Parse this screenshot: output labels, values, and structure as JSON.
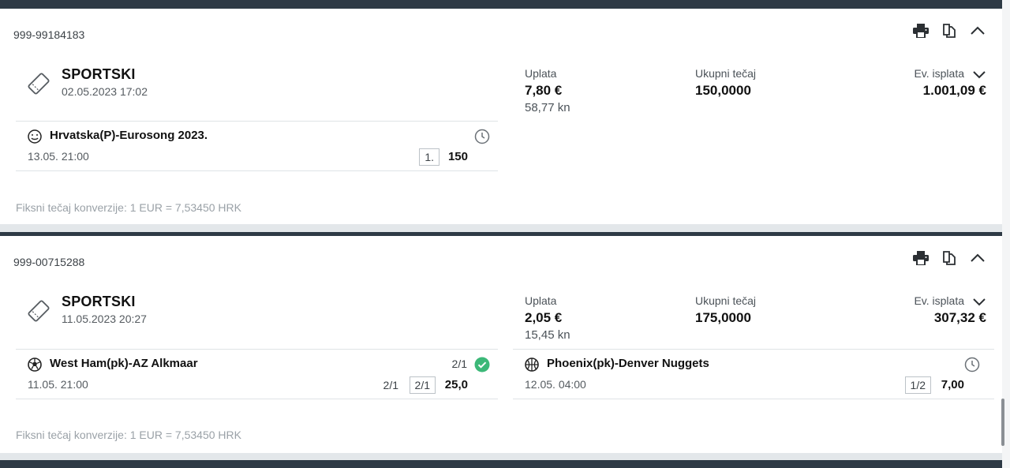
{
  "tickets": [
    {
      "id": "999-99184183",
      "type": "SPORTSKI",
      "date": "02.05.2023 17:02",
      "uplata_label": "Uplata",
      "uplata_eur": "7,80 €",
      "uplata_kn": "58,77 kn",
      "tecaj_label": "Ukupni tečaj",
      "tecaj": "150,0000",
      "isplata_label": "Ev. isplata",
      "isplata": "1.001,09 €",
      "events": [
        {
          "icon": "smiley-icon",
          "name": "Hrvatska(P)-Eurosong 2023.",
          "date": "13.05. 21:00",
          "tip": "1.",
          "odd": "150",
          "status": "clock-icon"
        }
      ],
      "conversion": "Fiksni tečaj konverzije: 1 EUR = 7,53450 HRK"
    },
    {
      "id": "999-00715288",
      "type": "SPORTSKI",
      "date": "11.05.2023 20:27",
      "uplata_label": "Uplata",
      "uplata_eur": "2,05 €",
      "uplata_kn": "15,45 kn",
      "tecaj_label": "Ukupni tečaj",
      "tecaj": "175,0000",
      "isplata_label": "Ev. isplata",
      "isplata": "307,32 €",
      "events": [
        {
          "icon": "soccer-ball-icon",
          "name": "West Ham(pk)-AZ Alkmaar",
          "date": "11.05. 21:00",
          "result": "2/1",
          "result_plain": "2/1",
          "tip": "2/1",
          "odd": "25,0",
          "status": "check-circle-icon"
        },
        {
          "icon": "basketball-icon",
          "name": "Phoenix(pk)-Denver Nuggets",
          "date": "12.05. 04:00",
          "tip": "1/2",
          "odd": "7,00",
          "status": "clock-icon"
        }
      ],
      "conversion": "Fiksni tečaj konverzije: 1 EUR = 7,53450 HRK"
    }
  ],
  "colors": {
    "header_bar": "#2e3a45",
    "success": "#3cb878",
    "muted": "#9aa1a7"
  }
}
